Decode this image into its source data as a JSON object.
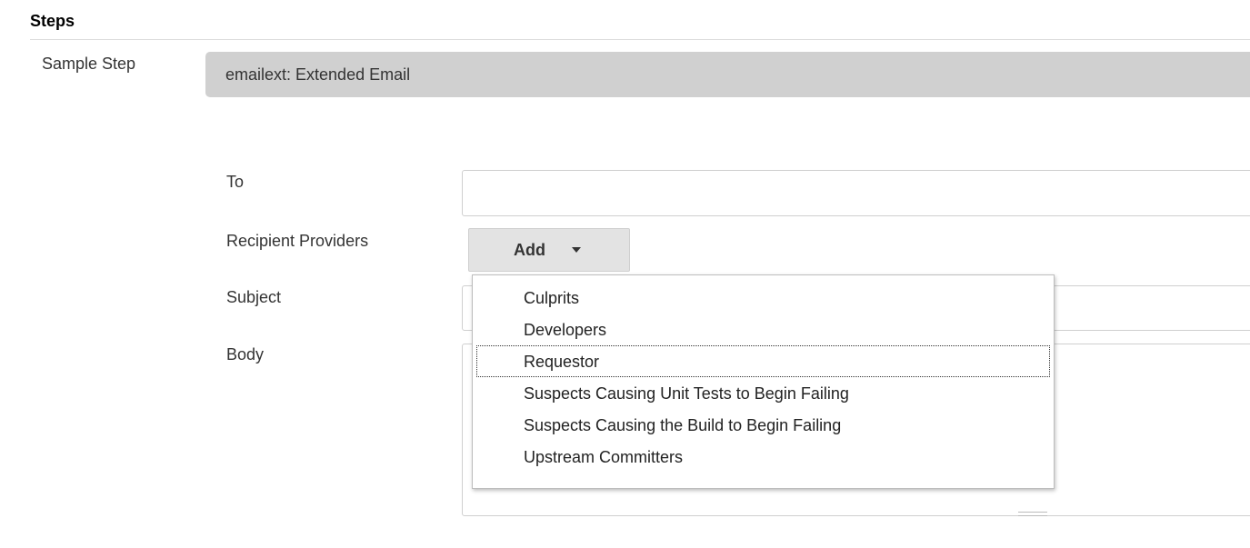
{
  "section": {
    "title": "Steps"
  },
  "sample_step": {
    "label": "Sample Step",
    "selected_value": "emailext: Extended Email"
  },
  "form": {
    "to": {
      "label": "To",
      "value": ""
    },
    "recipient_providers": {
      "label": "Recipient Providers",
      "add_button_label": "Add",
      "menu_items": [
        "Culprits",
        "Developers",
        "Requestor",
        "Suspects Causing Unit Tests to Begin Failing",
        "Suspects Causing the Build to Begin Failing",
        "Upstream Committers"
      ],
      "focused_item": "Requestor"
    },
    "subject": {
      "label": "Subject",
      "value": ""
    },
    "body": {
      "label": "Body",
      "value": ""
    }
  },
  "icons": {
    "add_caret": "chevron-down-icon",
    "body_resize": "resize-grip-icon"
  },
  "colors": {
    "select_background": "#d0d0d0",
    "button_background": "#e3e3e3",
    "input_border": "#cfcfcf"
  }
}
